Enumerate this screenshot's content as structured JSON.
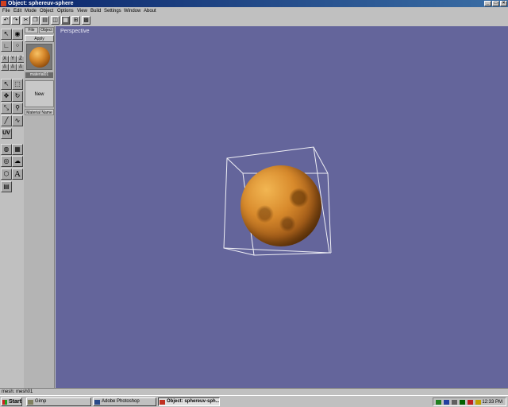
{
  "window": {
    "title": "Object: sphereuv-sphere",
    "buttons": [
      "_",
      "□",
      "×"
    ]
  },
  "menu": [
    "File",
    "Edit",
    "Mode",
    "Object",
    "Options",
    "View",
    "Build",
    "Settings",
    "Window",
    "About"
  ],
  "material_panel": {
    "tabs": [
      "File",
      "Object"
    ],
    "apply_label": "Apply",
    "material_name": "material01",
    "new_label": "New",
    "field_label": "Material Name"
  },
  "left_tools": {
    "uv_label": "UV",
    "text_tool_label": "A",
    "axis_labels": [
      "X",
      "Y",
      "Z"
    ]
  },
  "viewport": {
    "label": "Perspective",
    "background": "#64659b"
  },
  "statusbar": {
    "text": "mesh: mesh01"
  },
  "taskbar": {
    "start_label": "Start",
    "tasks": [
      "Gimp",
      "Adobe Photoshop",
      "Object: sphereuv-sph..."
    ],
    "clock": "12:33 PM"
  }
}
